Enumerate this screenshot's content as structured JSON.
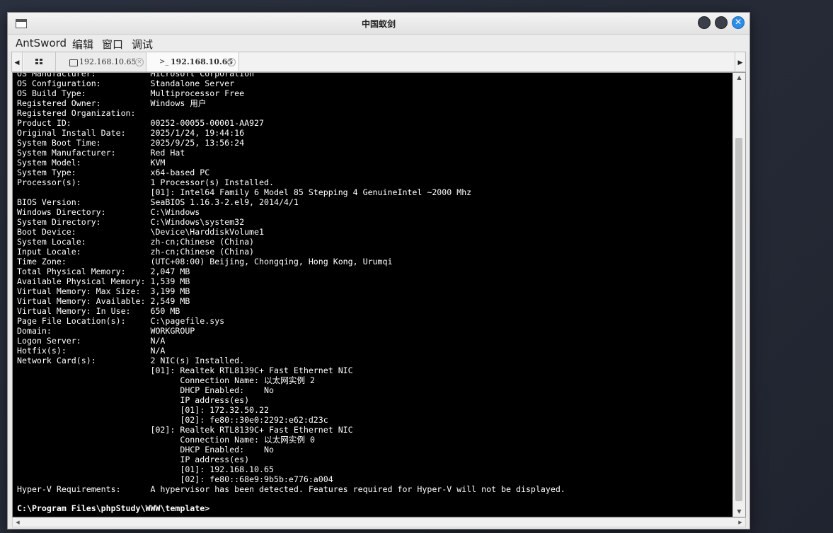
{
  "window": {
    "title": "中国蚁剑"
  },
  "menu": [
    "AntSword",
    "编辑",
    "窗口",
    "调试"
  ],
  "tabs": [
    {
      "label": "192.168.10.65",
      "icon": "folder-icon"
    },
    {
      "label": "192.168.10.65",
      "icon": "terminal-icon",
      "prefix": ">_"
    }
  ],
  "terminal": {
    "lines": [
      "OS Manufacturer:           Microsoft Corporation",
      "OS Configuration:          Standalone Server",
      "OS Build Type:             Multiprocessor Free",
      "Registered Owner:          Windows 用户",
      "Registered Organization:",
      "Product ID:                00252-00055-00001-AA927",
      "Original Install Date:     2025/1/24, 19:44:16",
      "System Boot Time:          2025/9/25, 13:56:24",
      "System Manufacturer:       Red Hat",
      "System Model:              KVM",
      "System Type:               x64-based PC",
      "Processor(s):              1 Processor(s) Installed.",
      "                           [01]: Intel64 Family 6 Model 85 Stepping 4 GenuineIntel ~2000 Mhz",
      "BIOS Version:              SeaBIOS 1.16.3-2.el9, 2014/4/1",
      "Windows Directory:         C:\\Windows",
      "System Directory:          C:\\Windows\\system32",
      "Boot Device:               \\Device\\HarddiskVolume1",
      "System Locale:             zh-cn;Chinese (China)",
      "Input Locale:              zh-cn;Chinese (China)",
      "Time Zone:                 (UTC+08:00) Beijing, Chongqing, Hong Kong, Urumqi",
      "Total Physical Memory:     2,047 MB",
      "Available Physical Memory: 1,539 MB",
      "Virtual Memory: Max Size:  3,199 MB",
      "Virtual Memory: Available: 2,549 MB",
      "Virtual Memory: In Use:    650 MB",
      "Page File Location(s):     C:\\pagefile.sys",
      "Domain:                    WORKGROUP",
      "Logon Server:              N/A",
      "Hotfix(s):                 N/A",
      "Network Card(s):           2 NIC(s) Installed.",
      "                           [01]: Realtek RTL8139C+ Fast Ethernet NIC",
      "                                 Connection Name: 以太网实例 2",
      "                                 DHCP Enabled:    No",
      "                                 IP address(es)",
      "                                 [01]: 172.32.50.22",
      "                                 [02]: fe80::30e0:2292:e62:d23c",
      "                           [02]: Realtek RTL8139C+ Fast Ethernet NIC",
      "                                 Connection Name: 以太网实例 0",
      "                                 DHCP Enabled:    No",
      "                                 IP address(es)",
      "                                 [01]: 192.168.10.65",
      "                                 [02]: fe80::68e9:9b5b:e776:a004",
      "Hyper-V Requirements:      A hypervisor has been detected. Features required for Hyper-V will not be displayed."
    ],
    "prompt": "C:\\Program Files\\phpStudy\\WWW\\template>"
  }
}
